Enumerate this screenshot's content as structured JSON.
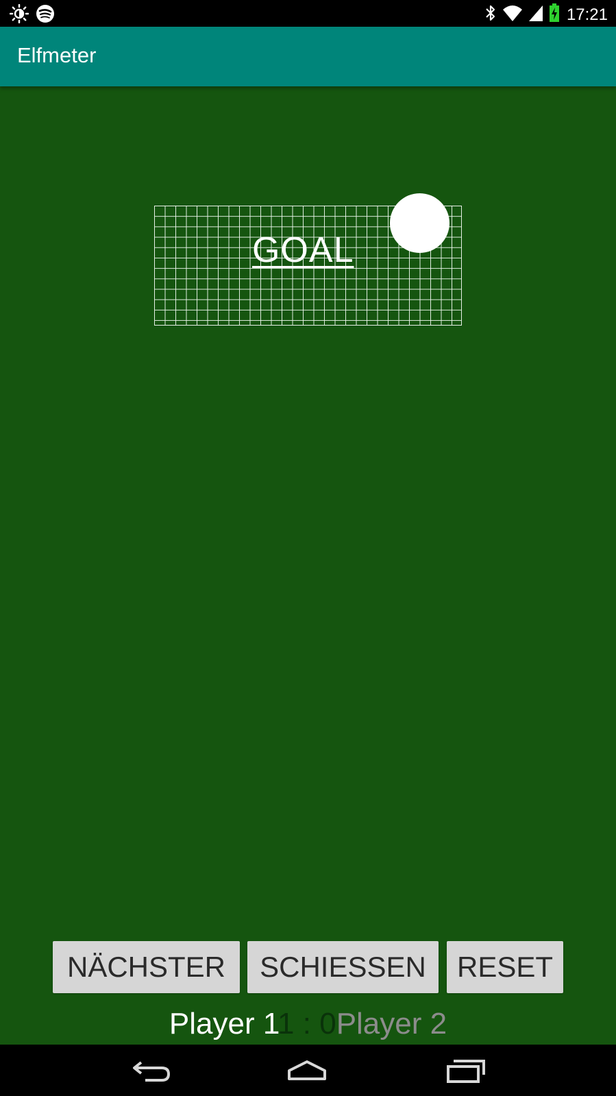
{
  "status_bar": {
    "time": "17:21",
    "left_icons": [
      "brightness-icon",
      "spotify-icon"
    ],
    "right_icons": [
      "bluetooth-icon",
      "wifi-icon",
      "signal-icon",
      "battery-charging-icon"
    ]
  },
  "app_bar": {
    "title": "Elfmeter"
  },
  "field": {
    "goal_label": "GOAL",
    "colors": {
      "field": "#15550f",
      "net": "#ffffff",
      "ball": "#ffffff"
    }
  },
  "controls": {
    "next_label": "NÄCHSTER",
    "shoot_label": "SCHIESSEN",
    "reset_label": "RESET"
  },
  "scoreboard": {
    "player1": "Player 1",
    "score1": "1",
    "separator": " : ",
    "score2": "0",
    "player2": "Player 2"
  },
  "nav_bar": {
    "buttons": [
      "back-icon",
      "home-icon",
      "recents-icon"
    ]
  },
  "colors": {
    "app_bar": "#00857a",
    "button": "#d6d6d6",
    "status_bar": "#000000"
  }
}
